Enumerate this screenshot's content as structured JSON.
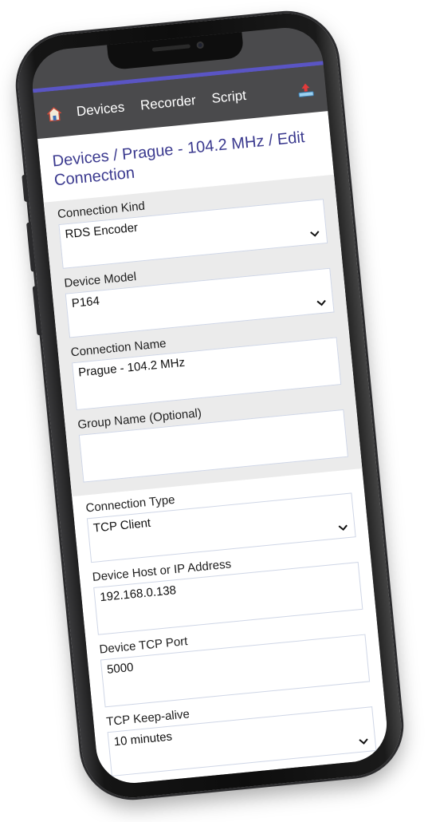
{
  "nav": {
    "items": [
      "Devices",
      "Recorder",
      "Script"
    ]
  },
  "breadcrumb": "Devices / Prague - 104.2 MHz / Edit Connection",
  "form": {
    "connection_kind": {
      "label": "Connection Kind",
      "value": "RDS Encoder"
    },
    "device_model": {
      "label": "Device Model",
      "value": "P164"
    },
    "connection_name": {
      "label": "Connection Name",
      "value": "Prague - 104.2 MHz"
    },
    "group_name": {
      "label": "Group Name (Optional)",
      "value": ""
    },
    "connection_type": {
      "label": "Connection Type",
      "value": "TCP Client"
    },
    "device_host": {
      "label": "Device Host or IP Address",
      "value": "192.168.0.138"
    },
    "device_port": {
      "label": "Device TCP Port",
      "value": "5000"
    },
    "keep_alive": {
      "label": "TCP Keep-alive",
      "value": "10 minutes"
    }
  },
  "colors": {
    "accent": "#5a55c4",
    "nav_bg": "#4a4a4c",
    "breadcrumb": "#3b3a8f",
    "section_grey": "#ebebeb"
  },
  "icons": {
    "home": "home-icon",
    "upload": "upload-icon",
    "dropdown": "chevron-down-icon"
  }
}
